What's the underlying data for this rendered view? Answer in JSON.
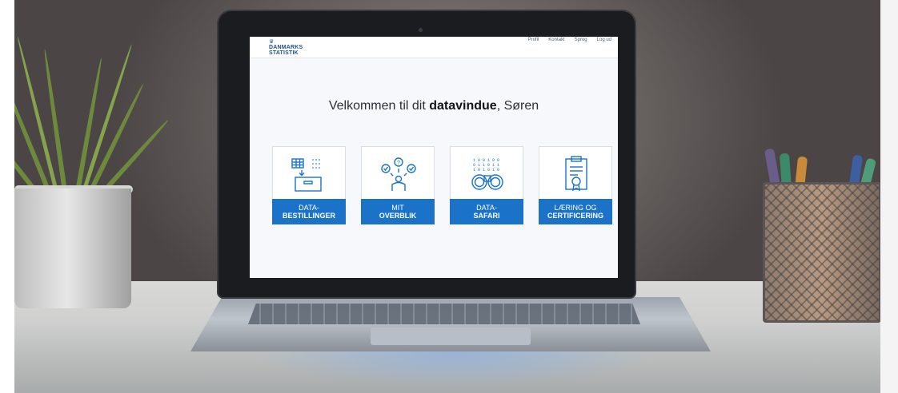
{
  "colors": {
    "brand_blue": "#1a73c9",
    "logo_blue": "#1f4f8f",
    "screen_bg": "#f7f8fb"
  },
  "header": {
    "logo_line1": "DANMARKS",
    "logo_line2": "STATISTIK",
    "nav": [
      "Profil",
      "Kontakt",
      "Sprog",
      "Log ud"
    ]
  },
  "welcome": {
    "prefix": "Velkommen til dit ",
    "highlight": "datavindue",
    "suffix": ", Søren"
  },
  "tiles": [
    {
      "line1": "DATA-",
      "line2": "BESTILLINGER",
      "icon": "data-order-box-icon"
    },
    {
      "line1": "MIT",
      "line2": "OVERBLIK",
      "icon": "overview-checks-icon"
    },
    {
      "line1": "DATA-",
      "line2": "SAFARI",
      "icon": "binoculars-icon"
    },
    {
      "line1": "LÆRING OG",
      "line2": "CERTIFICERING",
      "icon": "certificate-clipboard-icon"
    }
  ]
}
